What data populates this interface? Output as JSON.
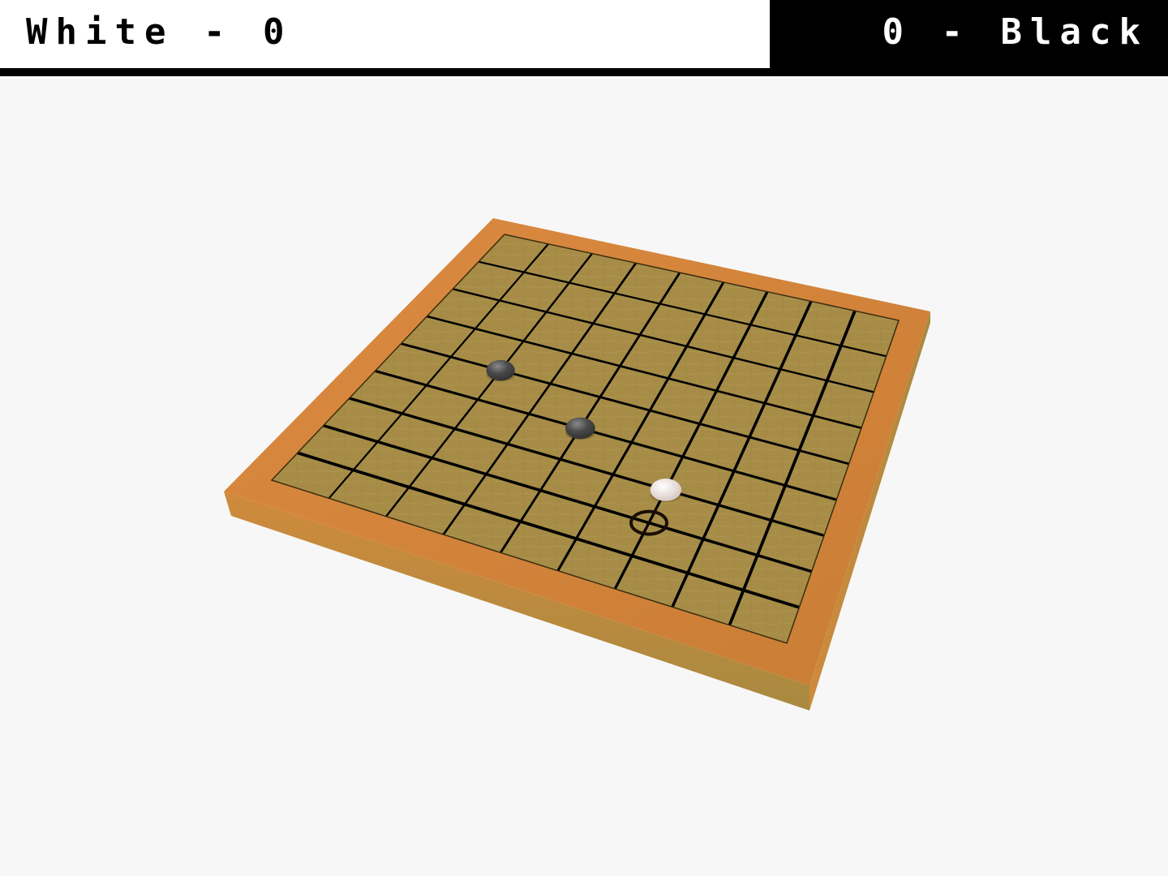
{
  "scoreboard": {
    "white_label": "White",
    "white_score": "0",
    "black_label": "Black",
    "black_score": "0",
    "separator": "-"
  },
  "board": {
    "size": 9,
    "frame_color": "#d4843c",
    "surface_color": "#a48a44",
    "line_color": "#000000"
  },
  "stones": [
    {
      "color": "black",
      "col": 2,
      "row": 4
    },
    {
      "color": "black",
      "col": 4,
      "row": 5
    },
    {
      "color": "white",
      "col": 6,
      "row": 6
    }
  ],
  "cursor": {
    "col": 6,
    "row": 7
  }
}
